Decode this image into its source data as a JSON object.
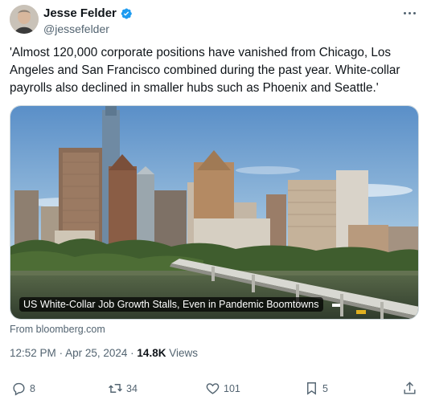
{
  "author": {
    "name": "Jesse Felder",
    "handle": "@jessefelder"
  },
  "tweet": {
    "text": "'Almost 120,000 corporate positions have vanished from Chicago, Los Angeles and San Francisco combined during the past year. White-collar payrolls also declined in smaller hubs such as Phoenix and Seattle.'"
  },
  "card": {
    "caption": "US White-Collar Job Growth Stalls, Even in Pandemic Boomtowns",
    "source": "From bloomberg.com"
  },
  "meta": {
    "time": "12:52 PM",
    "date": "Apr 25, 2024",
    "separator": "·",
    "views_count": "14.8K",
    "views_label": "Views"
  },
  "actions": {
    "replies": "8",
    "reposts": "34",
    "likes": "101",
    "bookmarks": "5"
  },
  "colors": {
    "verified": "#1d9bf0",
    "text": "#0f1419",
    "secondary": "#536471"
  }
}
